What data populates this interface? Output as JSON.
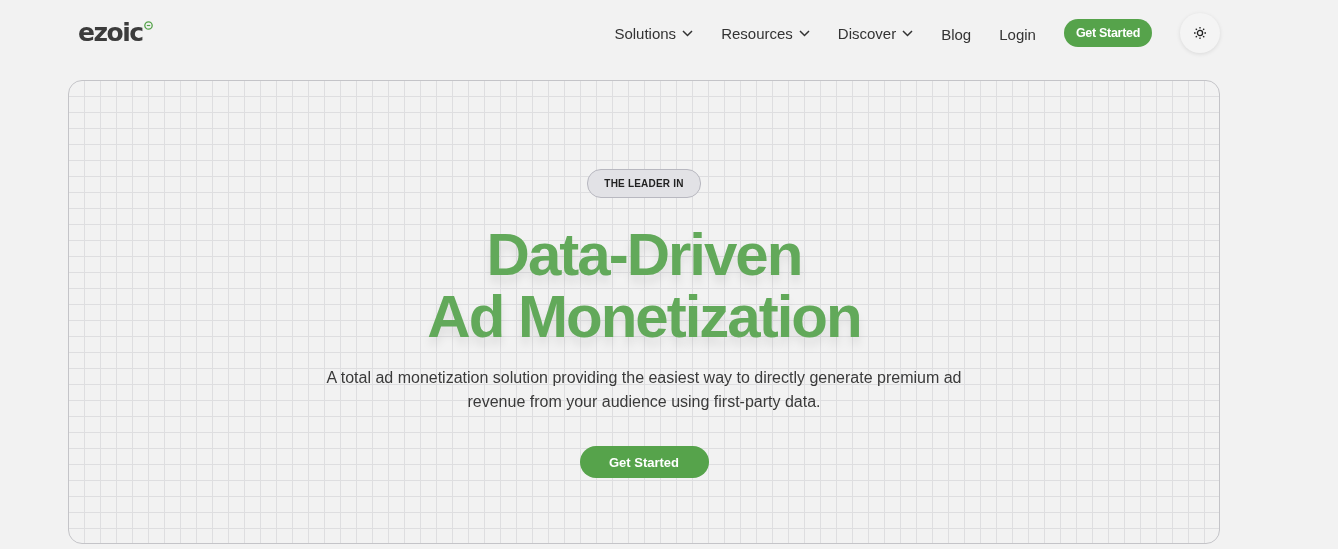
{
  "logo": {
    "text": "ezoic"
  },
  "nav": [
    {
      "label": "Solutions",
      "kind": "dropdown"
    },
    {
      "label": "Resources",
      "kind": "dropdown"
    },
    {
      "label": "Discover",
      "kind": "dropdown"
    },
    {
      "label": "Blog",
      "kind": "link"
    },
    {
      "label": "Login",
      "kind": "link"
    },
    {
      "label": "Get Started",
      "kind": "button"
    }
  ],
  "hero": {
    "badge": "THE LEADER IN",
    "title_lines": [
      "Data-Driven",
      "Ad Monetization"
    ],
    "description": "A total ad monetization solution providing the easiest way to directly generate premium ad revenue from your audience using first-party data.",
    "cta": "Get Started"
  }
}
